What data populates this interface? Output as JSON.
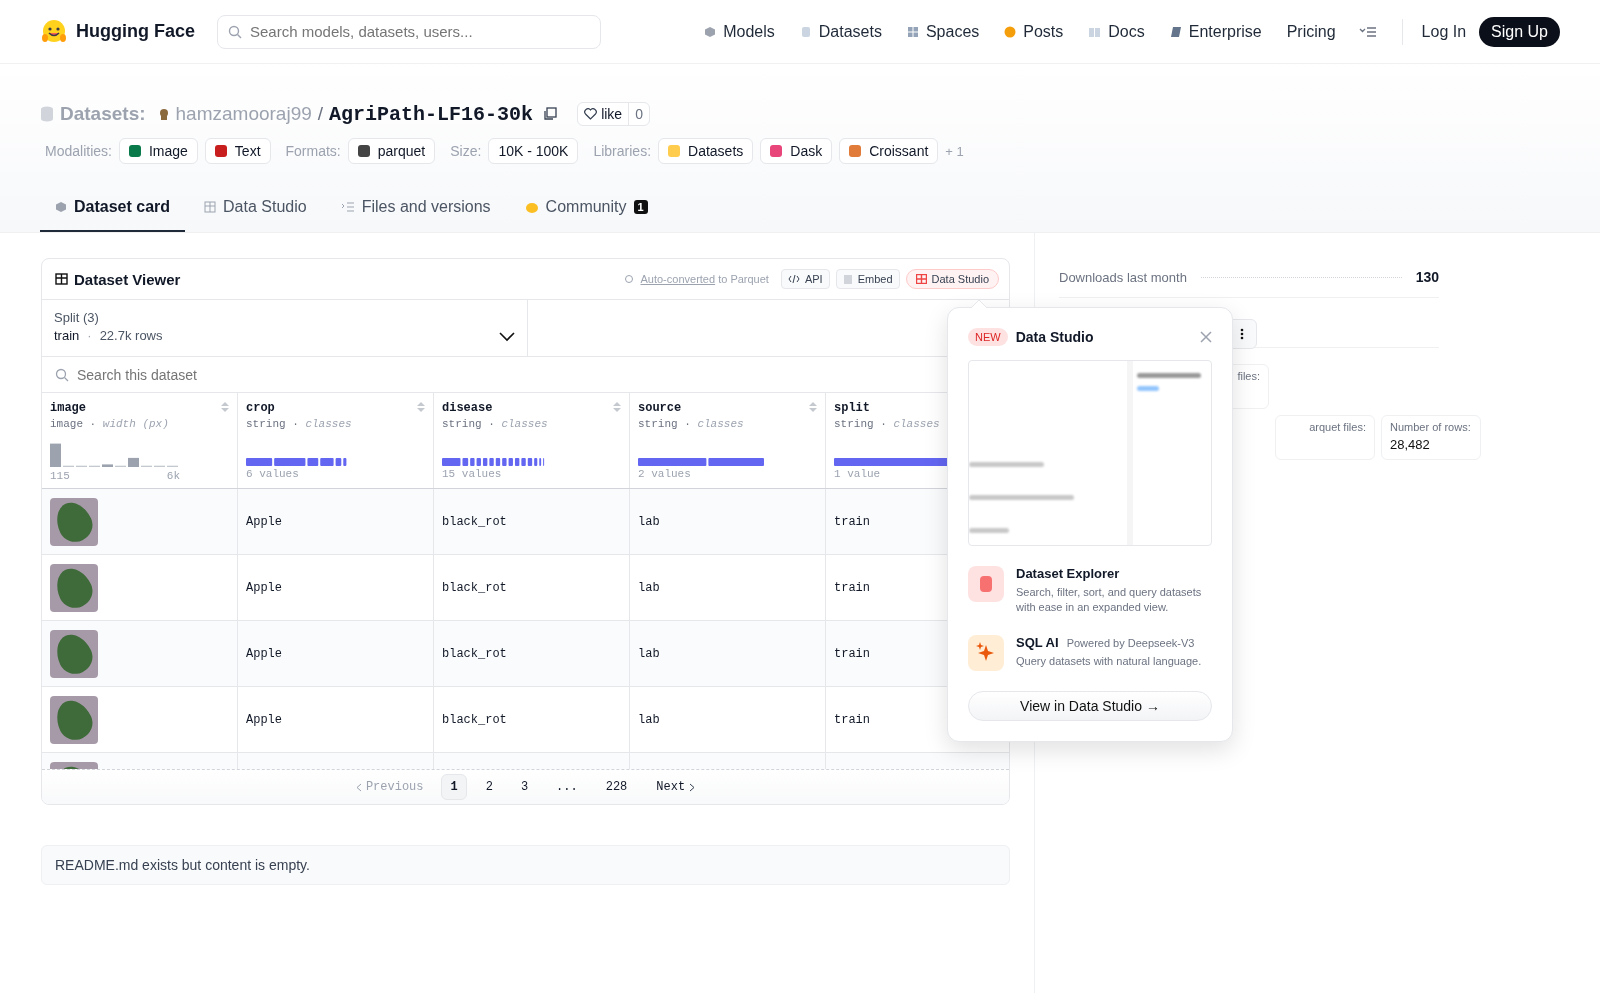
{
  "nav": {
    "brand": "Hugging Face",
    "search_placeholder": "Search models, datasets, users...",
    "links": [
      {
        "label": "Models"
      },
      {
        "label": "Datasets"
      },
      {
        "label": "Spaces"
      },
      {
        "label": "Posts"
      },
      {
        "label": "Docs"
      },
      {
        "label": "Enterprise"
      },
      {
        "label": "Pricing"
      }
    ],
    "login": "Log In",
    "signup": "Sign Up"
  },
  "repo": {
    "section": "Datasets:",
    "owner": "hamzamooraj99",
    "separator": "/",
    "name": "AgriPath-LF16-30k",
    "like_label": "like",
    "like_count": "0"
  },
  "tag_groups": [
    {
      "label": "Modalities:",
      "tags": [
        {
          "text": "Image"
        },
        {
          "text": "Text"
        }
      ]
    },
    {
      "label": "Formats:",
      "tags": [
        {
          "text": "parquet"
        }
      ]
    },
    {
      "label": "Size:",
      "tags": [
        {
          "text": "10K - 100K"
        }
      ]
    },
    {
      "label": "Libraries:",
      "tags": [
        {
          "text": "Datasets"
        },
        {
          "text": "Dask"
        },
        {
          "text": "Croissant"
        }
      ],
      "more": "+ 1"
    }
  ],
  "tabs": [
    {
      "label": "Dataset card",
      "selected": true
    },
    {
      "label": "Data Studio",
      "selected": false
    },
    {
      "label": "Files and versions",
      "selected": false
    },
    {
      "label": "Community",
      "selected": false,
      "badge": "1"
    }
  ],
  "viewer": {
    "title": "Dataset Viewer",
    "converted_link": "Auto-converted",
    "converted_text": "to Parquet",
    "buttons": [
      {
        "label": "API"
      },
      {
        "label": "Embed"
      },
      {
        "label": "Data Studio"
      }
    ],
    "split_label": "Split (3)",
    "split_value": "train",
    "split_separator": "·",
    "split_rows": "22.7k rows",
    "search_placeholder": "Search this dataset",
    "columns": [
      {
        "name": "image",
        "subtitle": "image · *width (px)*",
        "kind": "histogram",
        "min": "115",
        "max": "6k"
      },
      {
        "name": "crop",
        "subtitle": "string · *classes*",
        "kind": "classes",
        "footer": "6 values"
      },
      {
        "name": "disease",
        "subtitle": "string · *classes*",
        "kind": "classes",
        "footer": "15 values"
      },
      {
        "name": "source",
        "subtitle": "string · *classes*",
        "kind": "classes",
        "footer": "2 values"
      },
      {
        "name": "split",
        "subtitle": "string · *classes*",
        "kind": "classes",
        "footer": "1 value"
      }
    ],
    "rows": [
      {
        "cells": [
          "Apple",
          "black_rot",
          "lab",
          "train"
        ]
      },
      {
        "cells": [
          "Apple",
          "black_rot",
          "lab",
          "train"
        ]
      },
      {
        "cells": [
          "Apple",
          "black_rot",
          "lab",
          "train"
        ]
      },
      {
        "cells": [
          "Apple",
          "black_rot",
          "lab",
          "train"
        ]
      },
      {}
    ],
    "pagination": {
      "previous": "Previous",
      "next": "Next",
      "pages": [
        {
          "label": "1",
          "selected": true
        },
        {
          "label": "2",
          "selected": false
        },
        {
          "label": "3",
          "selected": false
        },
        {
          "label": "...",
          "selected": false
        },
        {
          "label": "228",
          "selected": false
        }
      ]
    }
  },
  "readme": "README.md exists but content is empty.",
  "sidebar": {
    "downloads_label": "Downloads last month",
    "downloads_value": "130",
    "cards": [
      {
        "label": "files:"
      },
      {
        "label": "arquet files:"
      },
      {
        "label": "Number of rows:",
        "value": "28,482"
      }
    ]
  },
  "popover": {
    "badge": "NEW",
    "title": "Data Studio",
    "features": [
      {
        "kind": "explorer",
        "title": "Dataset Explorer",
        "description": "Search, filter, sort, and query datasets with ease in an expanded view."
      },
      {
        "kind": "sql",
        "title": "SQL AI",
        "note": "Powered by Deepseek-V3",
        "description": "Query datasets with natural language."
      }
    ],
    "cta": "View in Data Studio →"
  }
}
